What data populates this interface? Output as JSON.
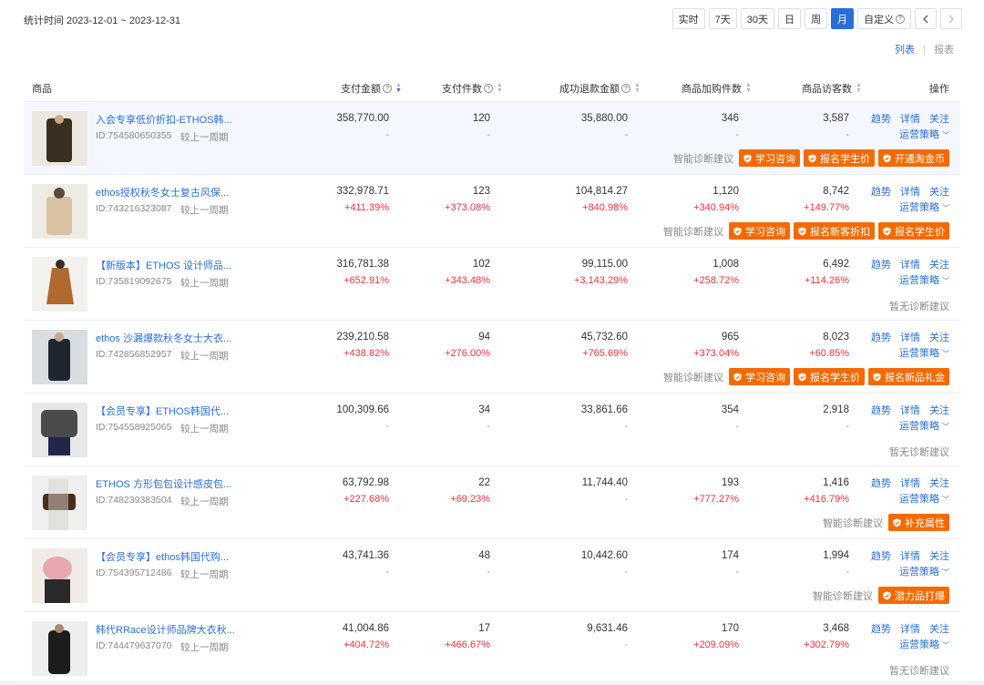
{
  "header": {
    "stat_time": "统计时间 2023-12-01 ~ 2023-12-31",
    "ranges": [
      "实时",
      "7天",
      "30天",
      "日",
      "周",
      "月",
      "自定义"
    ],
    "active_range": "月",
    "prev_icon": "chevron-left-icon",
    "next_icon": "chevron-right-icon"
  },
  "view_switch": {
    "list": "列表",
    "separator": "|",
    "report": "报表"
  },
  "columns": {
    "product": "商品",
    "pay_amount": "支付金额",
    "pay_count": "支付件数",
    "refund_amount": "成功退款金额",
    "cart_count": "商品加购件数",
    "visitors": "商品访客数",
    "ops": "操作"
  },
  "ops_labels": {
    "trend": "趋势",
    "detail": "详情",
    "follow": "关注",
    "strategy": "运营策略"
  },
  "diag_label": "智能诊断建议",
  "no_diag_label": "暂无诊断建议",
  "colors": {
    "accent": "#2a6ed8",
    "increase": "#f0323c",
    "tag": "#f56a00"
  },
  "rows": [
    {
      "title": "入会专享低价折扣-ETHOS韩...",
      "id": "ID:754580650355",
      "compare": "较上一周期",
      "pay_amount": "358,770.00",
      "pay_amount_chg": "-",
      "pay_count": "120",
      "pay_count_chg": "-",
      "refund_amount": "35,880.00",
      "refund_amount_chg": "-",
      "cart_count": "346",
      "cart_count_chg": "-",
      "visitors": "3,587",
      "visitors_chg": "-",
      "tags": [
        "学习咨询",
        "报名学生价",
        "开通淘金币"
      ]
    },
    {
      "title": "ethos授权秋冬女士复古风保...",
      "id": "ID:743216323087",
      "compare": "较上一周期",
      "pay_amount": "332,978.71",
      "pay_amount_chg": "+411.39%",
      "pay_count": "123",
      "pay_count_chg": "+373.08%",
      "refund_amount": "104,814.27",
      "refund_amount_chg": "+840.98%",
      "cart_count": "1,120",
      "cart_count_chg": "+340.94%",
      "visitors": "8,742",
      "visitors_chg": "+149.77%",
      "tags": [
        "学习咨询",
        "报名新客折扣",
        "报名学生价"
      ]
    },
    {
      "title": "【新版本】ETHOS 设计师品...",
      "id": "ID:735819092675",
      "compare": "较上一周期",
      "pay_amount": "316,781.38",
      "pay_amount_chg": "+652.91%",
      "pay_count": "102",
      "pay_count_chg": "+343.48%",
      "refund_amount": "99,115.00",
      "refund_amount_chg": "+3,143.29%",
      "cart_count": "1,008",
      "cart_count_chg": "+258.72%",
      "visitors": "6,492",
      "visitors_chg": "+114.26%",
      "tags": []
    },
    {
      "title": "ethos 沙漏爆款秋冬女士大衣...",
      "id": "ID:742856852957",
      "compare": "较上一周期",
      "pay_amount": "239,210.58",
      "pay_amount_chg": "+438.82%",
      "pay_count": "94",
      "pay_count_chg": "+276.00%",
      "refund_amount": "45,732.60",
      "refund_amount_chg": "+765.69%",
      "cart_count": "965",
      "cart_count_chg": "+373.04%",
      "visitors": "8,023",
      "visitors_chg": "+60.85%",
      "tags": [
        "学习咨询",
        "报名学生价",
        "报名新品礼金"
      ]
    },
    {
      "title": "【会员专享】ETHOS韩国代...",
      "id": "ID:754558925065",
      "compare": "较上一周期",
      "pay_amount": "100,309.66",
      "pay_amount_chg": "-",
      "pay_count": "34",
      "pay_count_chg": "-",
      "refund_amount": "33,861.66",
      "refund_amount_chg": "-",
      "cart_count": "354",
      "cart_count_chg": "-",
      "visitors": "2,918",
      "visitors_chg": "-",
      "tags": []
    },
    {
      "title": "ETHOS 方形包包设计感皮包...",
      "id": "ID:748239383504",
      "compare": "较上一周期",
      "pay_amount": "63,792.98",
      "pay_amount_chg": "+227.68%",
      "pay_count": "22",
      "pay_count_chg": "+69.23%",
      "refund_amount": "11,744.40",
      "refund_amount_chg": "-",
      "cart_count": "193",
      "cart_count_chg": "+777.27%",
      "visitors": "1,416",
      "visitors_chg": "+416.79%",
      "tags": [
        "补充属性"
      ]
    },
    {
      "title": "【会员专享】ethos韩国代购...",
      "id": "ID:754395712486",
      "compare": "较上一周期",
      "pay_amount": "43,741.36",
      "pay_amount_chg": "-",
      "pay_count": "48",
      "pay_count_chg": "-",
      "refund_amount": "10,442.60",
      "refund_amount_chg": "-",
      "cart_count": "174",
      "cart_count_chg": "-",
      "visitors": "1,994",
      "visitors_chg": "-",
      "tags": [
        "潜力品打爆"
      ]
    },
    {
      "title": "韩代RRace设计师品牌大衣秋...",
      "id": "ID:744479637070",
      "compare": "较上一周期",
      "pay_amount": "41,004.86",
      "pay_amount_chg": "+404.72%",
      "pay_count": "17",
      "pay_count_chg": "+466.67%",
      "refund_amount": "9,631.46",
      "refund_amount_chg": "-",
      "cart_count": "170",
      "cart_count_chg": "+209.09%",
      "visitors": "3,468",
      "visitors_chg": "+302.79%",
      "tags": []
    }
  ]
}
